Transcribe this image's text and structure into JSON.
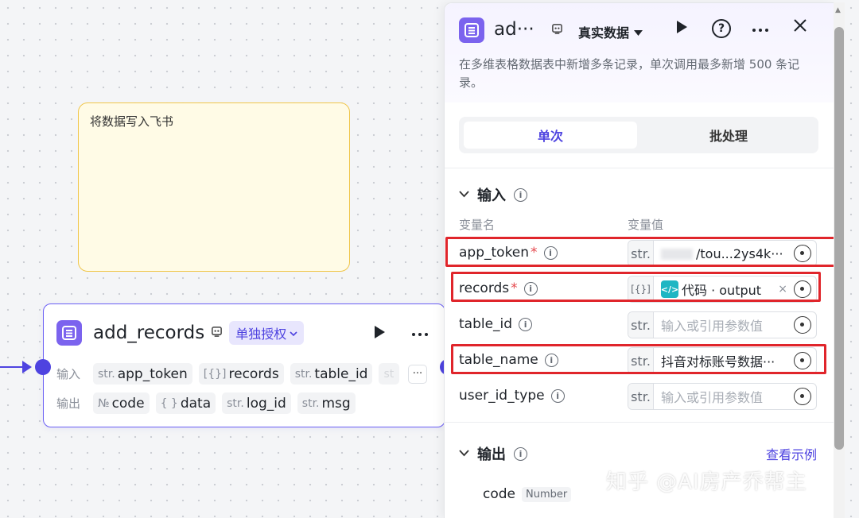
{
  "canvas": {
    "note_text": "将数据写入飞书",
    "node": {
      "title": "add_records",
      "auth_label": "单独授权",
      "input_label": "输入",
      "output_label": "输出",
      "inputs": [
        {
          "type": "str.",
          "name": "app_token"
        },
        {
          "type": "[{}]",
          "name": "records"
        },
        {
          "type": "str.",
          "name": "table_id"
        },
        {
          "type": "st",
          "name": ""
        }
      ],
      "outputs": [
        {
          "type": "№",
          "name": "code"
        },
        {
          "type": "{ }",
          "name": "data"
        },
        {
          "type": "str.",
          "name": "log_id"
        },
        {
          "type": "str.",
          "name": "msg"
        }
      ],
      "more_label": "···"
    }
  },
  "panel": {
    "title": "ad···",
    "data_mode": "真实数据",
    "description": "在多维表格数据表中新增多条记录，单次调用最多新增 500 条记录。",
    "tabs": [
      "单次",
      "批处理"
    ],
    "input_section": "输入",
    "col_name": "变量名",
    "col_value": "变量值",
    "params": [
      {
        "name": "app_token",
        "required": true,
        "type": "str.",
        "value": "/tou...2ys4k···"
      },
      {
        "name": "records",
        "required": true,
        "type": "[{}]",
        "ref_icon": "</>",
        "ref_text": "代码 · output"
      },
      {
        "name": "table_id",
        "required": false,
        "type": "str.",
        "placeholder": "输入或引用参数值"
      },
      {
        "name": "table_name",
        "required": false,
        "type": "str.",
        "value": "抖音对标账号数据···"
      },
      {
        "name": "user_id_type",
        "required": false,
        "type": "str.",
        "placeholder": "输入或引用参数值"
      }
    ],
    "output_section": "输出",
    "example_link": "查看示例",
    "output_code": {
      "name": "code",
      "type": "Number"
    }
  },
  "watermark": "知乎 @AI房产乔帮主",
  "colors": {
    "accent": "#4e43e0",
    "app_icon": "#7b63ee",
    "highlight": "#e0252b",
    "note_border": "#f0c64a",
    "code_ref": "#1fb6c3"
  }
}
